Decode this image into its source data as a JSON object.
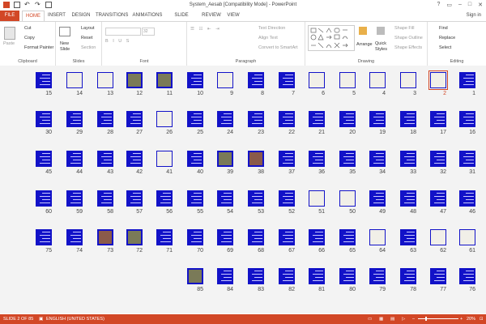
{
  "window": {
    "title": "System_Aesab [Compatibility Mode] - PowerPoint"
  },
  "tabs": [
    "FILE",
    "HOME",
    "INSERT",
    "DESIGN",
    "TRANSITIONS",
    "ANIMATIONS",
    "SLIDE SHOW",
    "REVIEW",
    "VIEW"
  ],
  "account": {
    "sign_in": "Sign in"
  },
  "ribbon": {
    "clipboard": {
      "label": "Clipboard",
      "paste": "Paste",
      "cut": "Cut",
      "copy": "Copy",
      "format_painter": "Format Painter"
    },
    "slides": {
      "label": "Slides",
      "new_slide_1": "New",
      "new_slide_2": "Slide",
      "layout": "Layout",
      "reset": "Reset",
      "section": "Section"
    },
    "font": {
      "label": "Font",
      "size": "32"
    },
    "paragraph": {
      "label": "Paragraph",
      "text_direction": "Text Direction",
      "align_text": "Align Text",
      "convert_smartart": "Convert to SmartArt"
    },
    "drawing": {
      "label": "Drawing",
      "arrange": "Arrange",
      "quick_styles_1": "Quick",
      "quick_styles_2": "Styles",
      "shape_fill": "Shape Fill",
      "shape_outline": "Shape Outline",
      "shape_effects": "Shape Effects"
    },
    "editing": {
      "label": "Editing",
      "find": "Find",
      "replace": "Replace",
      "select": "Select"
    }
  },
  "slides": {
    "rows": [
      [
        15,
        14,
        13,
        12,
        11,
        10,
        9,
        8,
        7,
        6,
        5,
        4,
        3,
        2,
        1
      ],
      [
        30,
        29,
        28,
        27,
        26,
        25,
        24,
        23,
        22,
        21,
        20,
        19,
        18,
        17,
        16
      ],
      [
        45,
        44,
        43,
        42,
        41,
        40,
        39,
        38,
        37,
        36,
        35,
        34,
        33,
        32,
        31
      ],
      [
        60,
        59,
        58,
        57,
        56,
        55,
        54,
        53,
        52,
        51,
        50,
        49,
        48,
        47,
        46
      ],
      [
        75,
        74,
        73,
        72,
        71,
        70,
        69,
        68,
        67,
        66,
        65,
        64,
        63,
        62,
        61
      ],
      [
        85,
        84,
        83,
        82,
        81,
        80,
        79,
        78,
        77,
        76
      ]
    ],
    "selected": 2,
    "light": [
      2,
      3,
      4,
      5,
      6,
      9,
      11,
      12,
      13,
      14,
      26,
      38,
      39,
      41,
      51,
      50,
      64,
      62,
      61,
      72,
      73,
      85
    ],
    "photo": [
      12,
      11,
      39,
      38,
      72,
      73,
      85
    ]
  },
  "statusbar": {
    "slide_info": "SLIDE 2 OF 85",
    "language": "ENGLISH (UNITED STATES)",
    "zoom": "20%"
  },
  "colors": {
    "accent": "#d24726",
    "slide_blue": "#1212c8"
  }
}
